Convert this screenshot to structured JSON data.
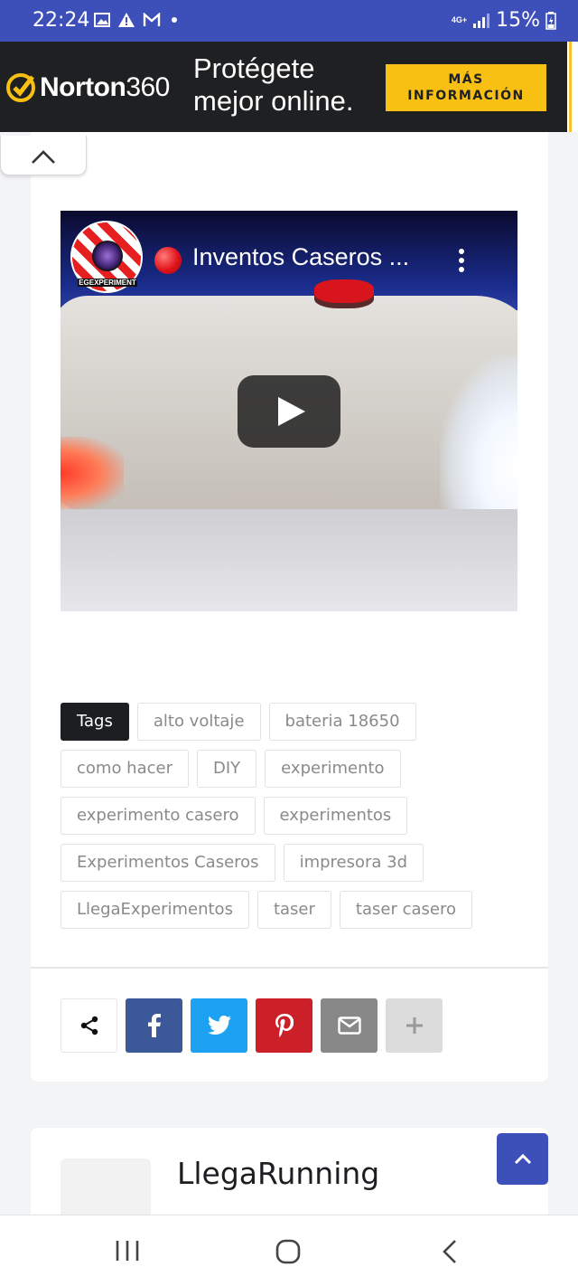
{
  "status_bar": {
    "time": "22:24",
    "network": "4G+",
    "battery": "15%",
    "icons": [
      "image-icon",
      "warning-icon",
      "gmail-icon",
      "dot-icon",
      "signal-icon",
      "battery-icon"
    ]
  },
  "ad": {
    "brand": "Norton",
    "brand_suffix": "360",
    "slogan_line1": "Protégete",
    "slogan_line2": "mejor online.",
    "cta_line1": "MÁS",
    "cta_line2": "INFORMACIÓN",
    "colors": {
      "background": "#1f2022",
      "cta": "#f7c012",
      "check": "#f7c012"
    }
  },
  "video": {
    "title": "Inventos Caseros ...",
    "channel_badge": "EGEXPERIMENT",
    "icons": [
      "channel-avatar",
      "record-icon",
      "more-vert-icon",
      "play-icon"
    ]
  },
  "tags": {
    "header": "Tags",
    "items": [
      "alto voltaje",
      "bateria 18650",
      "como hacer",
      "DIY",
      "experimento",
      "experimento casero",
      "experimentos",
      "Experimentos Caseros",
      "impresora 3d",
      "LlegaExperimentos",
      "taser",
      "taser casero"
    ]
  },
  "share": {
    "buttons": [
      {
        "name": "share",
        "icon": "share-icon",
        "color": "#ffffff"
      },
      {
        "name": "facebook",
        "icon": "facebook-icon",
        "color": "#3b5998"
      },
      {
        "name": "twitter",
        "icon": "twitter-icon",
        "color": "#1da1f2"
      },
      {
        "name": "pinterest",
        "icon": "pinterest-icon",
        "color": "#cb2027"
      },
      {
        "name": "email",
        "icon": "mail-icon",
        "color": "#888888"
      },
      {
        "name": "more",
        "icon": "plus-icon",
        "color": "#dcdcdc"
      }
    ]
  },
  "author": {
    "name": "LlegaRunning"
  },
  "colors": {
    "accent": "#3d4fb8",
    "tag_header_bg": "#1c1e22"
  }
}
